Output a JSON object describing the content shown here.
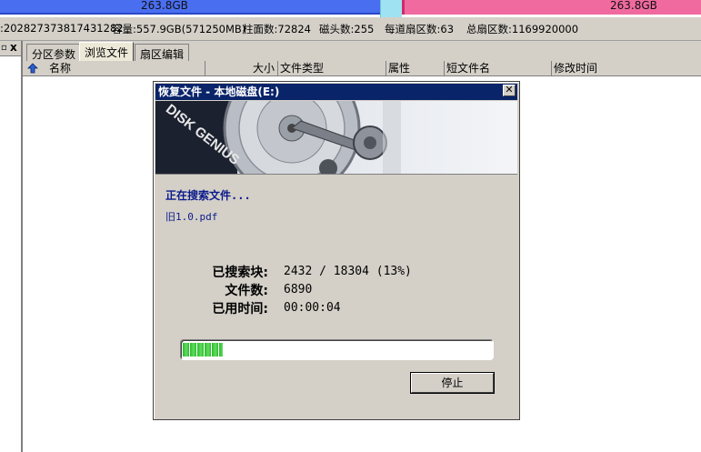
{
  "partitions": {
    "left_size": "263.8GB",
    "right_size": "263.8GB"
  },
  "info": {
    "serial_fragment": ":20282737381743128​2",
    "capacity": "容量:557.9GB(571250MB)",
    "cylinders": "柱面数:72824",
    "heads": "磁头数:255",
    "sectors_per_track": "每道扇区数:63",
    "total_sectors": "总扇区数:1169920000"
  },
  "tree": {
    "close_glyph": "x"
  },
  "tabs": [
    {
      "label": "分区参数"
    },
    {
      "label": "浏览文件"
    },
    {
      "label": "扇区编辑"
    }
  ],
  "columns": {
    "name": "名称",
    "size": "大小",
    "type": "文件类型",
    "attr": "属性",
    "short": "短文件名",
    "modified": "修改时间"
  },
  "dialog": {
    "title": "恢复文件 - 本地磁盘(E:)",
    "close_glyph": "✕",
    "status": "正在搜索文件...",
    "current_file": "旧1.0.pdf",
    "searched_label": "已搜索块:",
    "searched_value": "2432 / 18304 (13%)",
    "files_label": "文件数:",
    "files_value": "6890",
    "elapsed_label": "已用时间:",
    "elapsed_value": "00:00:04",
    "progress_fraction": 0.13,
    "stop_label": "停止",
    "banner_text": "DISK GENIUS"
  }
}
